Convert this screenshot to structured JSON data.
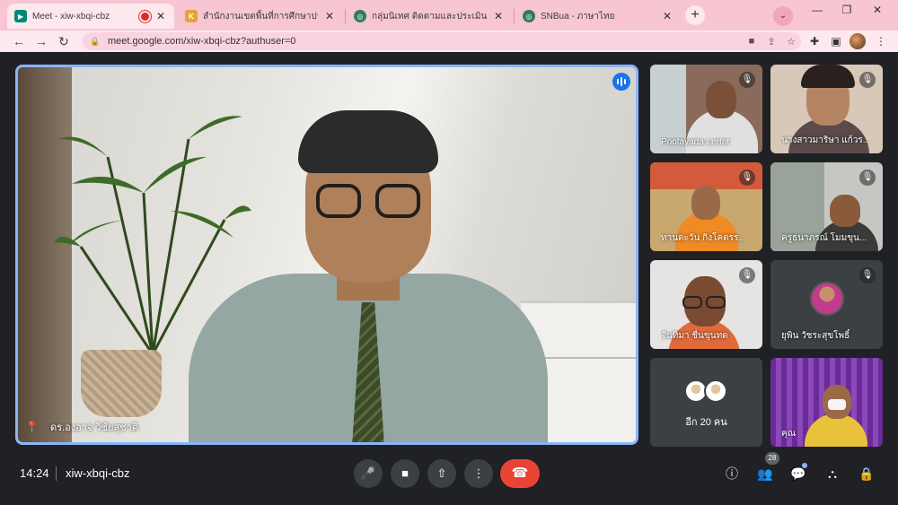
{
  "browser": {
    "tabs": [
      {
        "title": "Meet - xiw-xbqi-cbz",
        "recording": true
      },
      {
        "title": "สำนักงานเขตพื้นที่การศึกษาประถมศึกษ"
      },
      {
        "title": "กลุ่มนิเทศ ติดตามและประเมินผลการจัด"
      },
      {
        "title": "SNBua - ภาษาไทย"
      }
    ],
    "url": "meet.google.com/xiw-xbqi-cbz?authuser=0"
  },
  "meeting": {
    "main_speaker": "ดร.องอาจ วิชัยสุชาติ",
    "participants": [
      {
        "name": "Pootayada Lertrit"
      },
      {
        "name": "นางสาวมาริษา แก้วร..."
      },
      {
        "name": "ทานตะวัน กิ่งโคตรร..."
      },
      {
        "name": "ครูธนาภรณ์ โมมขุน..."
      },
      {
        "name": "จันทิมา ชื่นขุนทด"
      },
      {
        "name": "ยุพิน วัชระสุขโพธิ์"
      },
      {
        "name": "คุณ"
      }
    ],
    "more_label": "อีก 20 คน",
    "time": "14:24",
    "code": "xiw-xbqi-cbz",
    "people_count": "28"
  },
  "colors": {
    "accent": "#8ab4f8",
    "hangup": "#ea4335",
    "tabstrip": "#f7c6d2"
  }
}
